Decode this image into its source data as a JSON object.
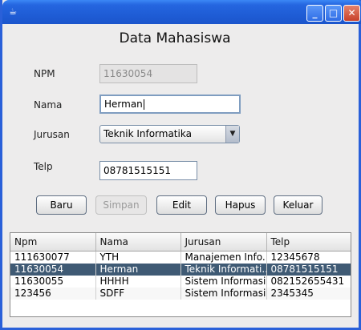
{
  "window": {
    "app_icon": "java-icon",
    "controls": {
      "minimize": "_",
      "maximize": "□",
      "close": "✕"
    }
  },
  "form": {
    "title": "Data Mahasiswa",
    "npm": {
      "label": "NPM",
      "value": "11630054",
      "enabled": false
    },
    "nama": {
      "label": "Nama",
      "value": "Herman",
      "focused": true
    },
    "jurusan": {
      "label": "Jurusan",
      "selected": "Teknik Informatika"
    },
    "telp": {
      "label": "Telp",
      "value": "08781515151"
    }
  },
  "buttons": {
    "baru": "Baru",
    "simpan": "Simpan",
    "edit": "Edit",
    "hapus": "Hapus",
    "keluar": "Keluar"
  },
  "table": {
    "columns": [
      "Npm",
      "Nama",
      "Jurusan",
      "Telp"
    ],
    "rows": [
      [
        "111630077",
        "YTH",
        "Manajemen Info...",
        "12345678"
      ],
      [
        "11630054",
        "Herman",
        "Teknik Informati...",
        "08781515151"
      ],
      [
        "11630055",
        "HHHH",
        "Sistem Informasi",
        "082152655431"
      ],
      [
        "123456",
        "SDFF",
        "Sistem Informasi",
        "2345345"
      ]
    ],
    "selected_row": 1
  },
  "colors": {
    "titlebar": "#2566e0",
    "selection": "#3f5a74"
  }
}
